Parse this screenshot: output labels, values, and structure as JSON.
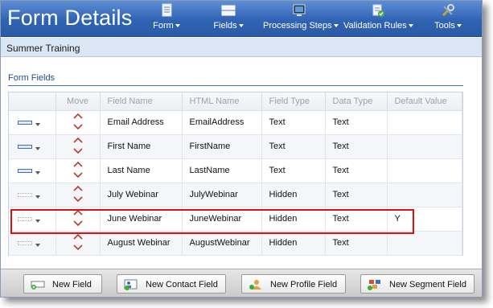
{
  "app": {
    "title": "Form Details"
  },
  "menu": [
    {
      "label": "Form",
      "icon": "form-icon"
    },
    {
      "label": "Fields",
      "icon": "fields-icon"
    },
    {
      "label": "Processing Steps",
      "icon": "processing-steps-icon"
    },
    {
      "label": "Validation Rules",
      "icon": "validation-rules-icon"
    },
    {
      "label": "Tools",
      "icon": "tools-icon"
    }
  ],
  "breadcrumb": "Summer Training",
  "section": {
    "title": "Form Fields"
  },
  "table": {
    "columns": [
      "",
      "Move",
      "Field Name",
      "HTML Name",
      "Field Type",
      "Data Type",
      "Default Value"
    ],
    "rows": [
      {
        "field_name": "Email Address",
        "html_name": "EmailAddress",
        "field_type": "Text",
        "data_type": "Text",
        "default_value": ""
      },
      {
        "field_name": "First Name",
        "html_name": "FirstName",
        "field_type": "Text",
        "data_type": "Text",
        "default_value": ""
      },
      {
        "field_name": "Last Name",
        "html_name": "LastName",
        "field_type": "Text",
        "data_type": "Text",
        "default_value": ""
      },
      {
        "field_name": "July Webinar",
        "html_name": "JulyWebinar",
        "field_type": "Hidden",
        "data_type": "Text",
        "default_value": ""
      },
      {
        "field_name": "June Webinar",
        "html_name": "JuneWebinar",
        "field_type": "Hidden",
        "data_type": "Text",
        "default_value": "Y"
      },
      {
        "field_name": "August Webinar",
        "html_name": "AugustWebinar",
        "field_type": "Hidden",
        "data_type": "Text",
        "default_value": ""
      }
    ]
  },
  "footer": {
    "buttons": [
      {
        "label": "New Field",
        "icon": "new-field-icon"
      },
      {
        "label": "New Contact Field",
        "icon": "new-contact-field-icon"
      },
      {
        "label": "New Profile Field",
        "icon": "new-profile-field-icon"
      },
      {
        "label": "New Segment Field",
        "icon": "new-segment-field-icon"
      }
    ]
  },
  "colors": {
    "header": "#2f63b3",
    "highlight": "#e01010",
    "move_arrow": "#c0392b"
  }
}
